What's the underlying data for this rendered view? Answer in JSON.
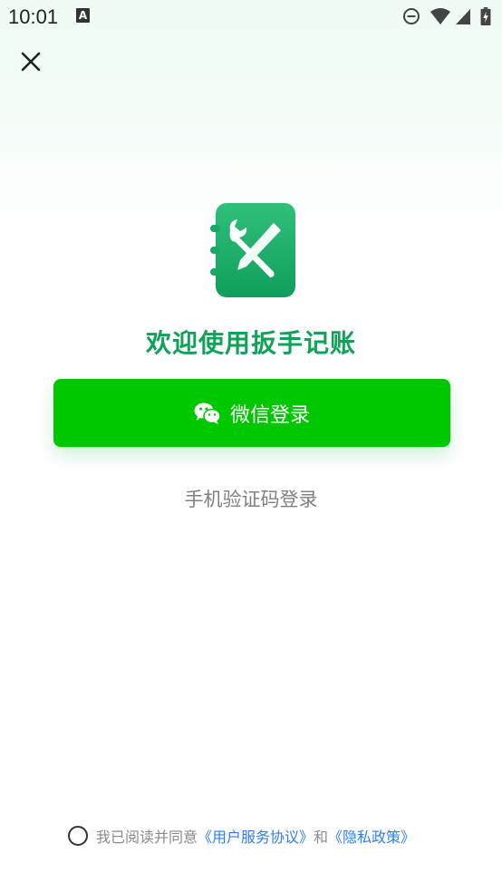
{
  "status_bar": {
    "time": "10:01",
    "notification_letter": "A",
    "icons": [
      "do-not-disturb-icon",
      "wifi-icon",
      "signal-icon",
      "battery-charging-icon"
    ]
  },
  "close_icon": "close-icon",
  "logo_icon": "wrench-pencil-notebook-icon",
  "title": "欢迎使用扳手记账",
  "wechat_button": {
    "label": "微信登录",
    "icon": "wechat-icon",
    "color": "#00c800"
  },
  "sms_login": "手机验证码登录",
  "agreement": {
    "prefix": "我已阅读并同意",
    "terms_link": "《用户服务协议》",
    "conjunction": "和",
    "privacy_link": "《隐私政策》",
    "checked": false
  },
  "colors": {
    "brand_green": "#0fa35a",
    "link_blue": "#2f7df6"
  }
}
